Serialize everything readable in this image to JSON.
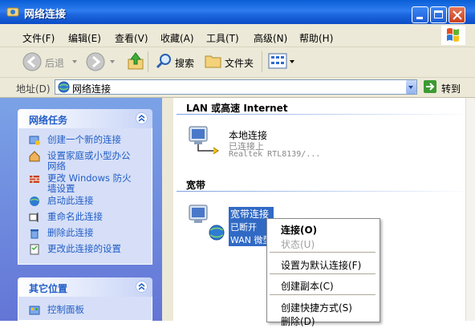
{
  "window": {
    "title": "网络连接"
  },
  "menu": [
    "文件(F)",
    "编辑(E)",
    "查看(V)",
    "收藏(A)",
    "工具(T)",
    "高级(N)",
    "帮助(H)"
  ],
  "toolbar": {
    "back": "后退",
    "search": "搜索",
    "folders": "文件夹"
  },
  "address": {
    "label": "地址(D)",
    "value": "网络连接",
    "go": "转到"
  },
  "tasks": {
    "title": "网络任务",
    "items": [
      "创建一个新的连接",
      "设置家庭或小型办公\n网络",
      "更改 Windows 防火\n墙设置",
      "启动此连接",
      "重命名此连接",
      "删除此连接",
      "更改此连接的设置"
    ]
  },
  "other": {
    "title": "其它位置",
    "items": [
      "控制面板"
    ]
  },
  "groups": [
    {
      "header": "LAN 或高速 Internet",
      "connections": [
        {
          "name": "本地连接",
          "status": "已连接上",
          "device": "Realtek RTL8139/..."
        }
      ]
    },
    {
      "header": "宽带",
      "connections": [
        {
          "name": "宽带连接",
          "status": "已断开",
          "device": "WAN 微型"
        }
      ]
    }
  ],
  "context_menu": {
    "items": [
      "连接(O)",
      "状态(U)",
      "设置为默认连接(F)",
      "创建副本(C)",
      "创建快捷方式(S)",
      "删除(D)"
    ]
  },
  "colors": {
    "titlebar": "#0a5fd6",
    "taskpane": "#7ba2e7",
    "selection": "#316ac5",
    "link": "#215dc6"
  }
}
